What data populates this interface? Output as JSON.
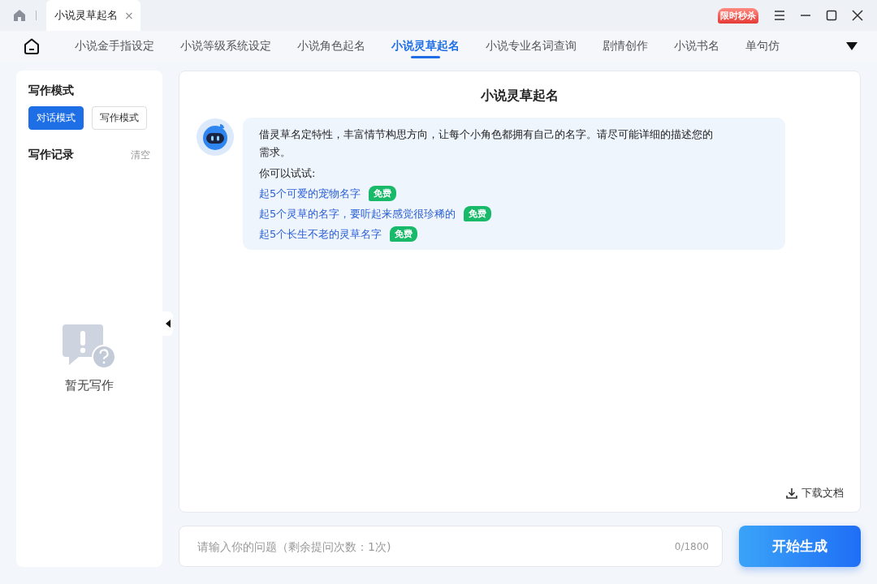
{
  "titlebar": {
    "tabs": [
      {
        "label": "小说灵草起名",
        "close": "×",
        "selected": true
      }
    ],
    "promo": "限时秒杀"
  },
  "nav": {
    "items": [
      {
        "label": "小说金手指设定",
        "selected": false
      },
      {
        "label": "小说等级系统设定",
        "selected": false
      },
      {
        "label": "小说角色起名",
        "selected": false
      },
      {
        "label": "小说灵草起名",
        "selected": true
      },
      {
        "label": "小说专业名词查询",
        "selected": false
      },
      {
        "label": "剧情创作",
        "selected": false
      },
      {
        "label": "小说书名",
        "selected": false
      },
      {
        "label": "单句仿",
        "selected": false
      }
    ]
  },
  "sidebar": {
    "mode_title": "写作模式",
    "modes": [
      {
        "label": "对话模式",
        "selected": true
      },
      {
        "label": "写作模式",
        "selected": false
      }
    ],
    "history_title": "写作记录",
    "clear": "清空",
    "empty_text": "暂无写作"
  },
  "chat": {
    "title": "小说灵草起名",
    "intro": "借灵草名定特性，丰富情节构思方向，让每个小角色都拥有自己的名字。请尽可能详细的描述您的需求。",
    "try_label": "你可以试试:",
    "suggestions": [
      {
        "text": "起5个可爱的宠物名字",
        "badge": "免费"
      },
      {
        "text": "起5个灵草的名字，要听起来感觉很珍稀的",
        "badge": "免费"
      },
      {
        "text": "起5个长生不老的灵草名字",
        "badge": "免费"
      }
    ],
    "download": "下载文档"
  },
  "input": {
    "placeholder": "请输入你的问题（剩余提问次数：1次)",
    "counter": "0/1800",
    "submit": "开始生成"
  }
}
